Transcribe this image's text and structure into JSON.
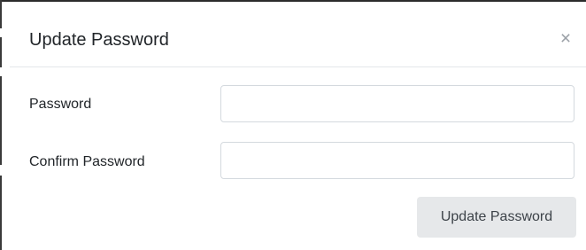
{
  "modal": {
    "title": "Update Password",
    "close_glyph": "×",
    "close_icon": "close-icon"
  },
  "form": {
    "password": {
      "label": "Password",
      "value": "",
      "placeholder": ""
    },
    "confirm_password": {
      "label": "Confirm Password",
      "value": "",
      "placeholder": ""
    },
    "submit_label": "Update Password"
  },
  "colors": {
    "button_bg": "#e6e8ea",
    "input_border": "#d4d9de",
    "divider": "#e3e6ea",
    "close_icon": "#9aa0a6"
  }
}
